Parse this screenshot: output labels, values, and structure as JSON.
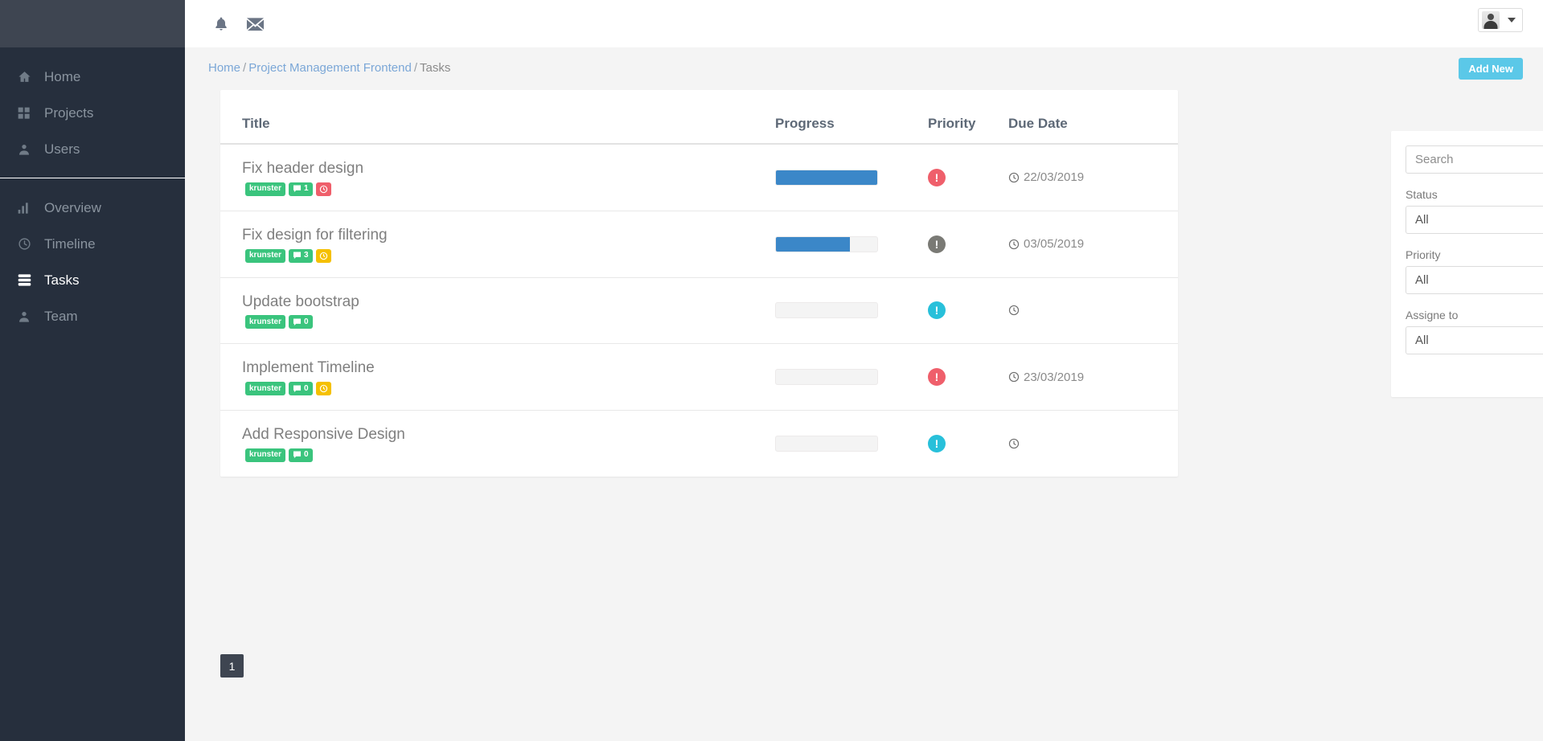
{
  "sidebar": {
    "groups": [
      {
        "items": [
          {
            "label": "Home",
            "icon": "home-icon",
            "active": false
          },
          {
            "label": "Projects",
            "icon": "grid-icon",
            "active": false
          },
          {
            "label": "Users",
            "icon": "user-icon",
            "active": false
          }
        ]
      },
      {
        "items": [
          {
            "label": "Overview",
            "icon": "bar-chart-icon",
            "active": false
          },
          {
            "label": "Timeline",
            "icon": "clock-icon",
            "active": false
          },
          {
            "label": "Tasks",
            "icon": "tasks-icon",
            "active": true
          },
          {
            "label": "Team",
            "icon": "user-icon",
            "active": false
          }
        ]
      }
    ]
  },
  "topbar": {
    "notifications_icon": "bell-icon",
    "messages_icon": "envelope-icon",
    "avatar_icon": "avatar",
    "caret_icon": "chevron-down-icon"
  },
  "breadcrumb": {
    "home": "Home",
    "project": "Project Management Frontend",
    "current": "Tasks",
    "separator": "/"
  },
  "actions": {
    "add_new": "Add New"
  },
  "table": {
    "headers": {
      "title": "Title",
      "progress": "Progress",
      "priority": "Priority",
      "due_date": "Due Date"
    },
    "rows": [
      {
        "title": "Fix header design",
        "assignee": "krunster",
        "comments": "1",
        "has_clock_badge": true,
        "clock_badge_color": "red",
        "progress": 100,
        "priority": "high",
        "due_date": "22/03/2019"
      },
      {
        "title": "Fix design for filtering",
        "assignee": "krunster",
        "comments": "3",
        "has_clock_badge": true,
        "clock_badge_color": "yellow",
        "progress": 73,
        "priority": "medium",
        "due_date": "03/05/2019"
      },
      {
        "title": "Update bootstrap",
        "assignee": "krunster",
        "comments": "0",
        "has_clock_badge": false,
        "clock_badge_color": "",
        "progress": 0,
        "priority": "low",
        "due_date": ""
      },
      {
        "title": "Implement Timeline",
        "assignee": "krunster",
        "comments": "0",
        "has_clock_badge": true,
        "clock_badge_color": "yellow",
        "progress": 0,
        "priority": "high",
        "due_date": "23/03/2019"
      },
      {
        "title": "Add Responsive Design",
        "assignee": "krunster",
        "comments": "0",
        "has_clock_badge": false,
        "clock_badge_color": "",
        "progress": 0,
        "priority": "low",
        "due_date": ""
      }
    ]
  },
  "filters": {
    "search_placeholder": "Search",
    "search_value": "",
    "status_label": "Status",
    "status_value": "All",
    "priority_label": "Priority",
    "priority_value": "All",
    "assignee_label": "Assigne to",
    "assignee_value": "All",
    "options": [
      "All"
    ]
  },
  "pagination": {
    "pages": [
      "1"
    ],
    "current": "1"
  },
  "colors": {
    "sidebar_bg": "#262f3d",
    "sidebar_top_bg": "#3e4551",
    "accent_blue": "#5bc8e8",
    "progress_blue": "#3b87c8",
    "badge_green": "#3ac47d",
    "priority_high": "#ef5f6b",
    "priority_medium": "#7a7a75",
    "priority_low": "#28c0da",
    "badge_yellow": "#f5c000"
  }
}
